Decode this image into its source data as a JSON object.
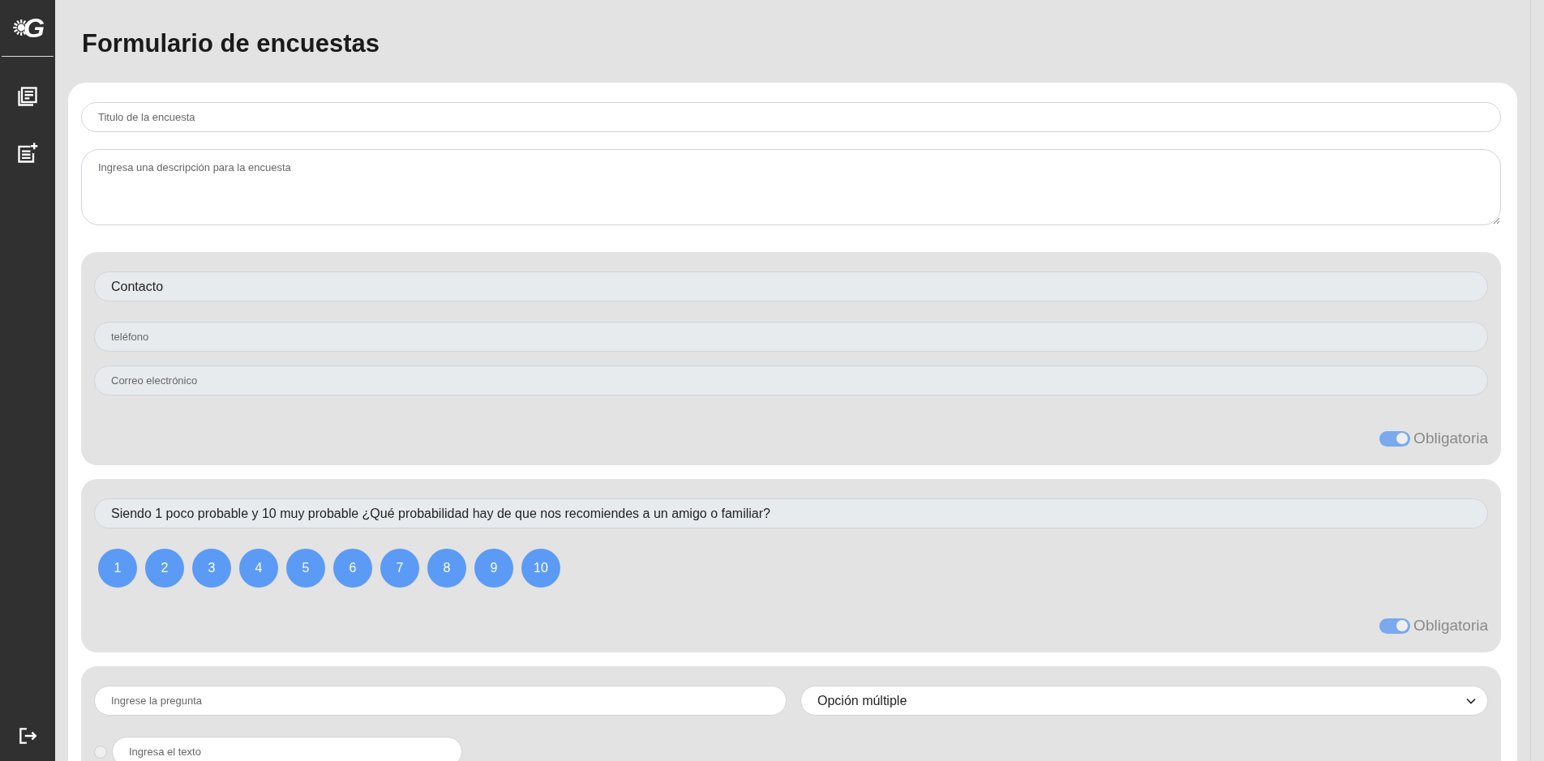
{
  "sidebar": {
    "logo_text": "G"
  },
  "page": {
    "title": "Formulario de encuestas"
  },
  "survey": {
    "title_field": {
      "placeholder": "Titulo de la encuesta"
    },
    "description_field": {
      "placeholder": "Ingresa una descripción para la encuesta"
    }
  },
  "questions": [
    {
      "kind": "contact",
      "question": "Contacto",
      "fields": [
        {
          "placeholder": "teléfono"
        },
        {
          "placeholder": "Correo electrónico"
        }
      ],
      "required": {
        "on": true,
        "label": "Obligatoria"
      }
    },
    {
      "kind": "scale",
      "question": "Siendo 1 poco probable y 10 muy probable ¿Qué probabilidad hay de que nos recomiendes a un amigo o familiar?",
      "options": [
        "1",
        "2",
        "3",
        "4",
        "5",
        "6",
        "7",
        "8",
        "9",
        "10"
      ],
      "required": {
        "on": true,
        "label": "Obligatoria"
      }
    },
    {
      "kind": "editor",
      "question_field": {
        "placeholder": "Ingrese la pregunta"
      },
      "type_select": {
        "value": "Opción múltiple"
      },
      "options": [
        {
          "placeholder": "Ingresa el texto",
          "checked": false
        }
      ]
    }
  ]
}
